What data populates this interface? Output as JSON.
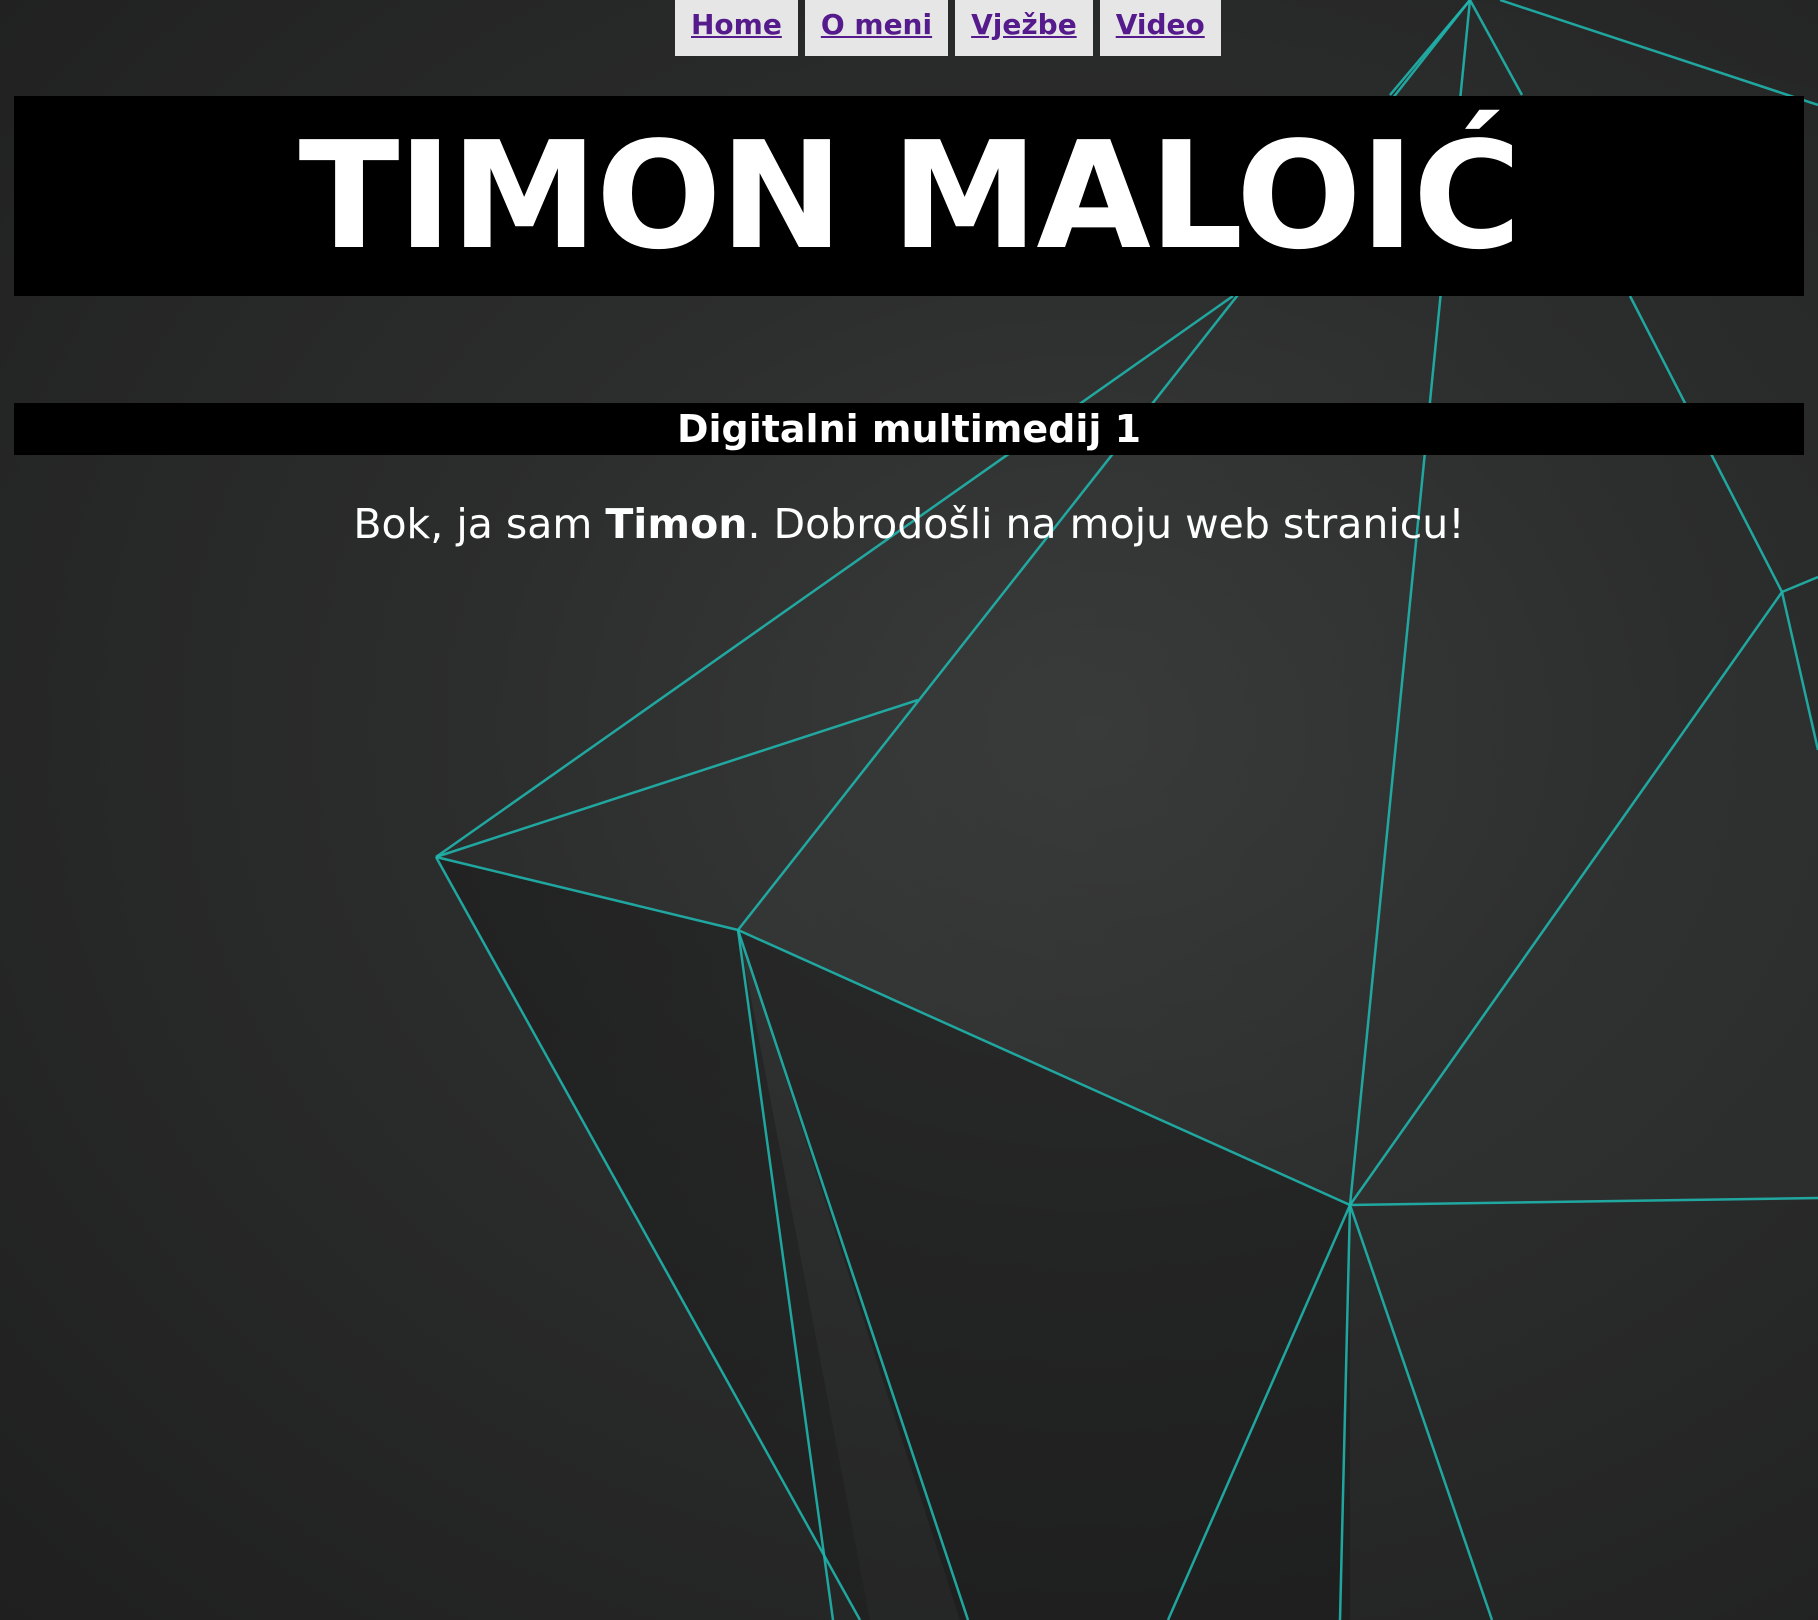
{
  "nav": {
    "items": [
      {
        "label": "Home"
      },
      {
        "label": "O meni"
      },
      {
        "label": "Vježbe"
      },
      {
        "label": "Video"
      }
    ]
  },
  "header": {
    "title": "TIMON MALOIĆ"
  },
  "subheader": {
    "title": "Digitalni multimedij 1"
  },
  "intro": {
    "prefix": "Bok, ja sam ",
    "name": "Timon",
    "suffix": ". Dobrodošli na moju web stranicu!"
  },
  "colors": {
    "background": "#2c2d2d",
    "line_accent": "#1fb5ad",
    "nav_bg": "#e6e6e6",
    "nav_link": "#551a8b",
    "banner_bg": "#000000"
  }
}
